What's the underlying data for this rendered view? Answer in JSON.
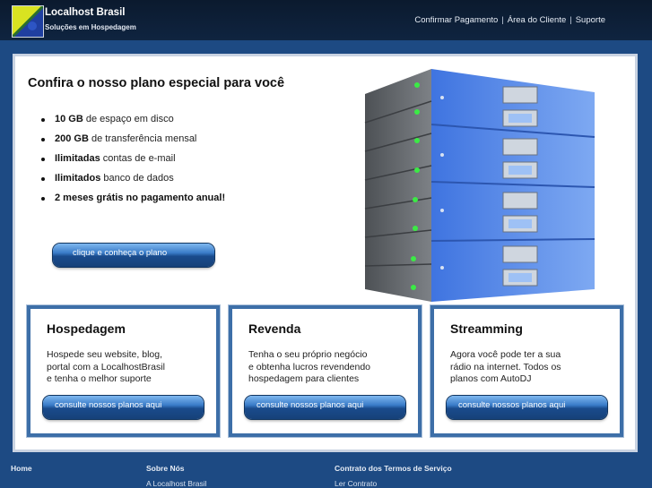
{
  "header": {
    "brand_name": "Localhost Brasil",
    "brand_tagline": "Soluções em Hospedagem",
    "nav": [
      {
        "label": "Confirmar Pagamento"
      },
      {
        "label": "Área do Cliente"
      },
      {
        "label": "Suporte"
      }
    ],
    "nav_separator": "|"
  },
  "promo": {
    "title": "Confira o nosso plano especial para você",
    "features": [
      {
        "strong": "10 GB",
        "text": " de espaço em disco"
      },
      {
        "strong": "200 GB",
        "text": " de transferência mensal"
      },
      {
        "strong": "Ilimitadas",
        "text": " contas de e-mail"
      },
      {
        "strong": "Ilimitados",
        "text": " banco de dados"
      },
      {
        "strong": "2 meses grátis no pagamento anual!",
        "text": ""
      }
    ],
    "cta_label": "clique e conheça o plano"
  },
  "cards": [
    {
      "title": "Hospedagem",
      "lines": [
        "Hospede seu website, blog,",
        "portal com a LocalhostBrasil",
        "e tenha o melhor suporte"
      ],
      "button": "consulte nossos planos aqui"
    },
    {
      "title": "Revenda",
      "lines": [
        "Tenha o seu próprio negócio",
        "e obtenha lucros revendendo",
        "hospedagem para clientes"
      ],
      "button": "consulte nossos planos aqui"
    },
    {
      "title": "Streamming",
      "lines": [
        "Agora você pode ter a sua",
        "rádio na internet. Todos os",
        "planos com AutoDJ"
      ],
      "button": "consulte nossos planos aqui"
    }
  ],
  "footer": {
    "col1": {
      "head": "Home"
    },
    "col2": {
      "head": "Sobre Nós",
      "link": "A Localhost Brasil"
    },
    "col3": {
      "head": "Contrato dos Termos de Serviço",
      "link": "Ler Contrato"
    }
  },
  "colors": {
    "background": "#1d4a83",
    "header": "#0b1a2e",
    "card_border": "#3d6fa8",
    "button": "#1a4b8c",
    "server_blue": "#5b8ee8",
    "server_grey": "#6e7277",
    "led_green": "#3bea45"
  },
  "icons": {
    "logo": "logo-mark-icon",
    "hero": "server-rack-illustration"
  }
}
